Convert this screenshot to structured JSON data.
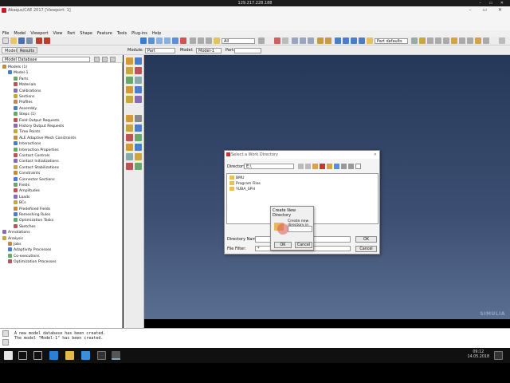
{
  "rdp": {
    "address": "129.217.228.188"
  },
  "app": {
    "title": "Abaqus/CAE 2017 [Viewport: 1]"
  },
  "menu": [
    "File",
    "Model",
    "Viewport",
    "View",
    "Part",
    "Shape",
    "Feature",
    "Tools",
    "Plug-ins",
    "Help"
  ],
  "toolbar": {
    "filter_value": "All",
    "defaults_value": "Part defaults"
  },
  "context": {
    "tabs": [
      "Model",
      "Results"
    ],
    "db_label": "Model Database",
    "module_label": "Module:",
    "module_value": "Part",
    "model_label": "Model:",
    "model_value": "Model-1",
    "part_label": "Part:",
    "part_value": ""
  },
  "tree": [
    {
      "t": "Models (1)",
      "d": 0
    },
    {
      "t": "Model-1",
      "d": 1
    },
    {
      "t": "Parts",
      "d": 2
    },
    {
      "t": "Materials",
      "d": 2
    },
    {
      "t": "Calibrations",
      "d": 2
    },
    {
      "t": "Sections",
      "d": 2
    },
    {
      "t": "Profiles",
      "d": 2
    },
    {
      "t": "Assembly",
      "d": 2
    },
    {
      "t": "Steps (1)",
      "d": 2
    },
    {
      "t": "Field Output Requests",
      "d": 2
    },
    {
      "t": "History Output Requests",
      "d": 2
    },
    {
      "t": "Time Points",
      "d": 2
    },
    {
      "t": "ALE Adaptive Mesh Constraints",
      "d": 2
    },
    {
      "t": "Interactions",
      "d": 2
    },
    {
      "t": "Interaction Properties",
      "d": 2
    },
    {
      "t": "Contact Controls",
      "d": 2
    },
    {
      "t": "Contact Initializations",
      "d": 2
    },
    {
      "t": "Contact Stabilizations",
      "d": 2
    },
    {
      "t": "Constraints",
      "d": 2
    },
    {
      "t": "Connector Sections",
      "d": 2
    },
    {
      "t": "Fields",
      "d": 2
    },
    {
      "t": "Amplitudes",
      "d": 2
    },
    {
      "t": "Loads",
      "d": 2
    },
    {
      "t": "BCs",
      "d": 2
    },
    {
      "t": "Predefined Fields",
      "d": 2
    },
    {
      "t": "Remeshing Rules",
      "d": 2
    },
    {
      "t": "Optimization Tasks",
      "d": 2
    },
    {
      "t": "Sketches",
      "d": 2
    },
    {
      "t": "Annotations",
      "d": 0
    },
    {
      "t": "Analysis",
      "d": 0
    },
    {
      "t": "Jobs",
      "d": 1
    },
    {
      "t": "Adaptivity Processes",
      "d": 1
    },
    {
      "t": "Co-executions",
      "d": 1
    },
    {
      "t": "Optimization Processes",
      "d": 1
    }
  ],
  "dialog": {
    "title": "Select a Work Directory",
    "directory_label": "Directory:",
    "directory_value": "E:\\",
    "folders": [
      "BMU",
      "Program Files",
      "YUBA_SPH"
    ],
    "dir_name_label": "Directory Name:",
    "file_filter_label": "File Filter:",
    "file_filter_value": "*",
    "ok": "OK",
    "cancel": "Cancel"
  },
  "subdialog": {
    "title": "Create New Directory",
    "prompt": "Create new directory in E:\\",
    "value": "",
    "ok": "OK",
    "cancel": "Cancel"
  },
  "messages": [
    "A new model database has been created.",
    "The model \"Model-1\" has been created."
  ],
  "brand": "SIMULIA",
  "clock": {
    "time": "09:12",
    "date": "14.05.2018"
  }
}
